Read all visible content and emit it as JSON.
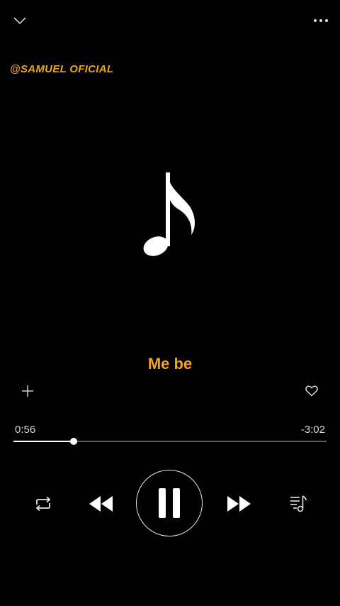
{
  "watermark": "@SAMUEL OFICIAL",
  "lyric": {
    "sung": "Me be",
    "pending": ""
  },
  "time": {
    "elapsed": "0:56",
    "remaining": "-3:02"
  },
  "progress": {
    "fraction": 0.193
  },
  "colors": {
    "accent": "#f0a324",
    "background": "#000000",
    "track": "#5a5a5a"
  },
  "icons": {
    "collapse": "chevron-down-icon",
    "menu": "more-dots-icon",
    "artwork": "music-note-icon",
    "add": "plus-icon",
    "like": "heart-icon",
    "repeat": "repeat-icon",
    "previous": "rewind-icon",
    "play_pause": "pause-icon",
    "next": "fast-forward-icon",
    "queue": "playlist-icon"
  }
}
